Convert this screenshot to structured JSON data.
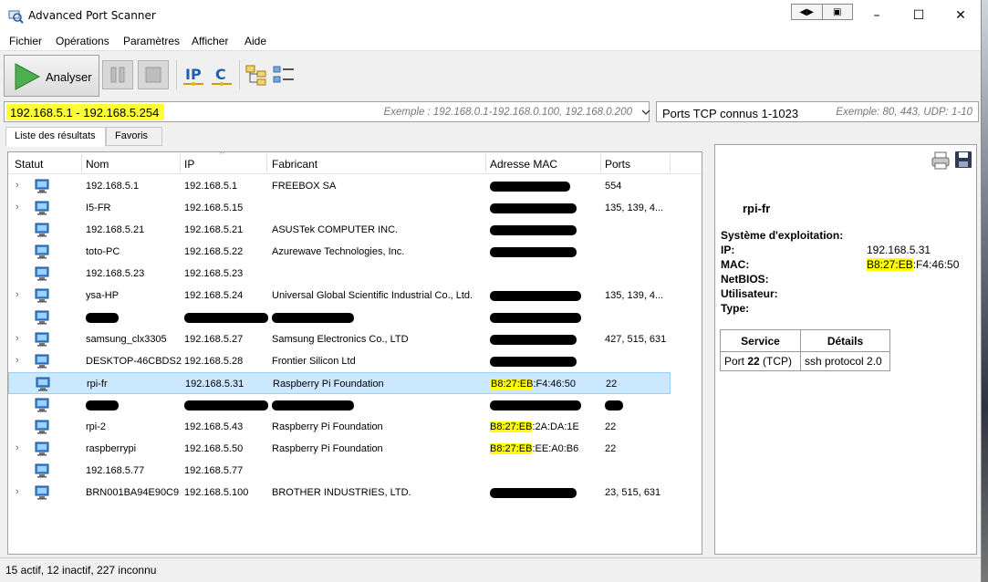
{
  "window": {
    "title": "Advanced Port Scanner",
    "minimize": "–",
    "maximize": "☐",
    "close": "✕"
  },
  "menu": [
    "Fichier",
    "Opérations",
    "Paramètres",
    "Afficher",
    "Aide"
  ],
  "toolbar": {
    "scan_label": "Analyser"
  },
  "range": {
    "value": "192.168.5.1 - 192.168.5.254",
    "placeholder": "Exemple : 192.168.0.1-192.168.0.100, 192.168.0.200"
  },
  "ports": {
    "value": "Ports TCP connus 1-1023",
    "placeholder": "Exemple: 80, 443, UDP: 1-10"
  },
  "tabs": [
    "Liste des résultats",
    "Favoris"
  ],
  "columns": [
    "Statut",
    "Nom",
    "IP",
    "Fabricant",
    "Adresse MAC",
    "Ports"
  ],
  "rows": [
    {
      "name": "192.168.5.1",
      "ip": "192.168.5.1",
      "vendor": "FREEBOX SA",
      "ports": "554"
    },
    {
      "name": "I5-FR",
      "ip": "192.168.5.15",
      "vendor": "",
      "ports": "135, 139, 4..."
    },
    {
      "name": "192.168.5.21",
      "ip": "192.168.5.21",
      "vendor": "ASUSTek COMPUTER INC.",
      "ports": ""
    },
    {
      "name": "toto-PC",
      "ip": "192.168.5.22",
      "vendor": "Azurewave Technologies, Inc.",
      "ports": ""
    },
    {
      "name": "192.168.5.23",
      "ip": "192.168.5.23",
      "vendor": "",
      "ports": ""
    },
    {
      "name": "ysa-HP",
      "ip": "192.168.5.24",
      "vendor": "Universal Global Scientific Industrial Co., Ltd.",
      "ports": "135, 139, 4..."
    },
    {
      "name": "",
      "ip": "",
      "vendor": "",
      "ports": ""
    },
    {
      "name": "samsung_clx3305",
      "ip": "192.168.5.27",
      "vendor": "Samsung Electronics Co., LTD",
      "ports": "427, 515, 631"
    },
    {
      "name": "DESKTOP-46CBDS2",
      "ip": "192.168.5.28",
      "vendor": "Frontier Silicon Ltd",
      "ports": ""
    },
    {
      "name": "rpi-fr",
      "ip": "192.168.5.31",
      "vendor": "Raspberry Pi Foundation",
      "mac_prefix": "B8:27:EB",
      "mac_suffix": ":F4:46:50",
      "ports": "22"
    },
    {
      "name": "",
      "ip": "",
      "vendor": "",
      "ports": ""
    },
    {
      "name": "rpi-2",
      "ip": "192.168.5.43",
      "vendor": "Raspberry Pi Foundation",
      "mac_prefix": "B8:27:EB",
      "mac_suffix": ":2A:DA:1E",
      "ports": "22"
    },
    {
      "name": "raspberrypi",
      "ip": "192.168.5.50",
      "vendor": "Raspberry Pi Foundation",
      "mac_prefix": "B8:27:EB",
      "mac_suffix": ":EE:A0:B6",
      "ports": "22"
    },
    {
      "name": "192.168.5.77",
      "ip": "192.168.5.77",
      "vendor": "",
      "ports": ""
    },
    {
      "name": "BRN001BA94E90C9",
      "ip": "192.168.5.100",
      "vendor": "BROTHER INDUSTRIES, LTD.",
      "ports": "23, 515, 631"
    }
  ],
  "details": {
    "name": "rpi-fr",
    "labels": {
      "os": "Système d'exploitation:",
      "ip": "IP:",
      "mac": "MAC:",
      "netbios": "NetBIOS:",
      "user": "Utilisateur:",
      "type": "Type:"
    },
    "ip": "192.168.5.31",
    "mac_prefix": "B8:27:EB",
    "mac_suffix": ":F4:46:50",
    "service_headers": [
      "Service",
      "Détails"
    ],
    "service_port_prefix": "Port ",
    "service_port_num": "22",
    "service_port_proto": " (TCP)",
    "service_detail": "ssh protocol 2.0"
  },
  "status": "15 actif, 12 inactif, 227 inconnu"
}
